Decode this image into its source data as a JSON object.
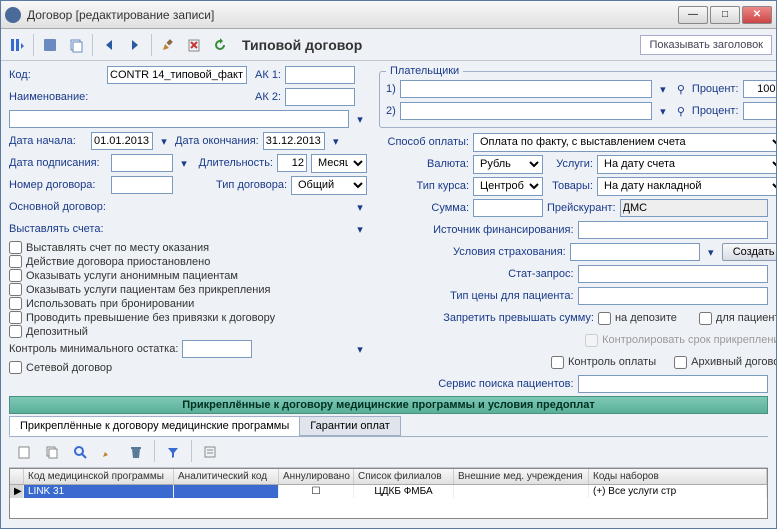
{
  "window": {
    "title": "Договор [редактирование записи]"
  },
  "toolbar": {
    "title": "Типовой договор",
    "show_header": "Показывать заголовок"
  },
  "form": {
    "code_lbl": "Код:",
    "code": "CONTR 14_типовой_факт",
    "ak1_lbl": "АК 1:",
    "ak1": "",
    "ak2_lbl": "АК 2:",
    "ak2": "",
    "name_lbl": "Наименование:",
    "name": "",
    "date_start_lbl": "Дата начала:",
    "date_start": "01.01.2013",
    "date_end_lbl": "Дата окончания:",
    "date_end": "31.12.2013",
    "date_sign_lbl": "Дата подписания:",
    "date_sign": "",
    "duration_lbl": "Длительность:",
    "duration": "12",
    "duration_unit": "Месяц",
    "num_lbl": "Номер договора:",
    "num": "",
    "type_lbl": "Тип договора:",
    "type": "Общий",
    "main_contract_lbl": "Основной договор:",
    "bill_prefix_lbl": "Выставлять счета:",
    "chk1": "Выставлять счет по месту оказания",
    "chk2": "Действие договора приостановлено",
    "chk3": "Оказывать услуги анонимным пациентам",
    "chk4": "Оказывать услуги пациентам без прикрепления",
    "chk5": "Использовать при бронировании",
    "chk6": "Проводить превышение без привязки к договору",
    "chk7": "Депозитный",
    "min_balance_lbl": "Контроль минимального остатка:",
    "chk8": "Сетевой договор"
  },
  "payers": {
    "legend": "Плательщики",
    "n1": "1)",
    "n2": "2)",
    "percent_lbl": "Процент:",
    "percent1": "100",
    "percent2": ""
  },
  "right": {
    "pay_method_lbl": "Способ оплаты:",
    "pay_method": "Оплата по факту, с выставлением счета",
    "currency_lbl": "Валюта:",
    "currency": "Рубль",
    "services_lbl": "Услуги:",
    "services": "На дату счета",
    "rate_type_lbl": "Тип курса:",
    "rate_type": "Центробанк Р",
    "goods_lbl": "Товары:",
    "goods": "На дату накладной",
    "sum_lbl": "Сумма:",
    "pricelist_lbl": "Прейскурант:",
    "pricelist": "ДМС",
    "fin_src_lbl": "Источник финансирования:",
    "ins_cond_lbl": "Условия страхования:",
    "create_btn": "Создать",
    "stat_lbl": "Стат-запрос:",
    "price_type_lbl": "Тип цены для пациента:",
    "forbid_exceed_lbl": "Запретить превышать сумму:",
    "on_deposit": "на депозите",
    "for_patient": "для пациента",
    "ctrl_attach": "Контролировать срок прикрепления",
    "ctrl_pay": "Контроль оплаты",
    "archive": "Архивный договор",
    "search_lbl": "Сервис поиска пациентов:"
  },
  "section": {
    "title": "Прикреплённые к договору медицинские программы и условия предоплат"
  },
  "tabs": {
    "t1": "Прикреплённые к договору медицинские программы",
    "t2": "Гарантии оплат"
  },
  "grid": {
    "h1": "Код медицинской программы",
    "h2": "Аналитический код",
    "h3": "Аннулировано",
    "h4": "Список филиалов",
    "h5": "Внешние мед. учреждения",
    "h6": "Коды наборов",
    "r1c1": "LINK 31",
    "r1c4": "ЦДКБ ФМБА",
    "r1c6": "(+) Все услуги стр"
  }
}
